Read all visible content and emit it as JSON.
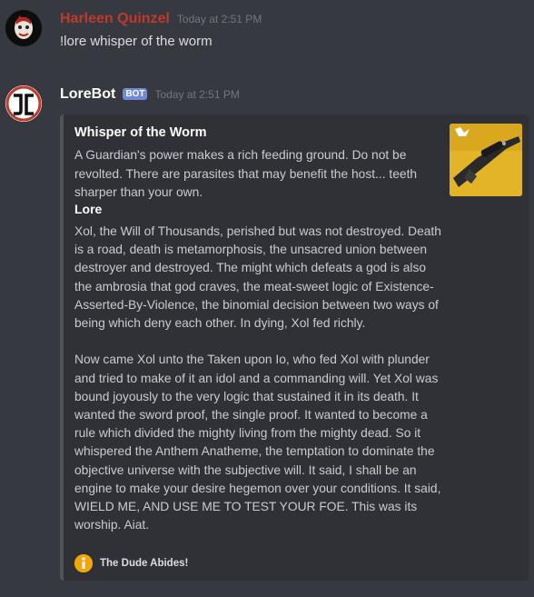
{
  "messages": [
    {
      "username": "Harleen Quinzel",
      "username_color": "#c0392b",
      "timestamp": "Today at 2:51 PM",
      "text": "!lore whisper of the worm"
    },
    {
      "username": "LoreBot",
      "username_color": "#ffffff",
      "bot_tag": "BOT",
      "timestamp": "Today at 2:51 PM",
      "embed": {
        "title": "Whisper of the Worm",
        "description": "A Guardian's power makes a rich feeding ground. Do not be revolted. There are parasites that may benefit the host... teeth sharper than your own.",
        "thumbnail_icon": "sniper-rifle-icon",
        "field_name": "Lore",
        "field_value": "Xol, the Will of Thousands, perished but was not destroyed. Death is a road, death is metamorphosis, the unsacred union between destroyer and destroyed. The might which defeats a god is also the ambrosia that god craves, the meat-sweet logic of Existence-Asserted-By-Violence, the binomial decision between two ways of being which deny each other. In dying, Xol fed richly.\n\nNow came Xol unto the Taken upon Io, who fed Xol with plunder and tried to make of it an idol and a commanding will. Yet Xol was bound joyously to the very logic that sustained it in its death. It wanted the sword proof, the single proof. It wanted to become a rule which divided the mighty living from the mighty dead. So it whispered the Anthem Anatheme, the temptation to dominate the objective universe with the subjective will. It said, I shall be an engine to make your desire hegemon over your conditions. It said, WIELD ME, AND USE ME TO TEST YOUR FOE. This was its worship. Aiat.",
        "footer_text": "The Dude Abides!",
        "footer_icon": "info-icon"
      }
    }
  ]
}
